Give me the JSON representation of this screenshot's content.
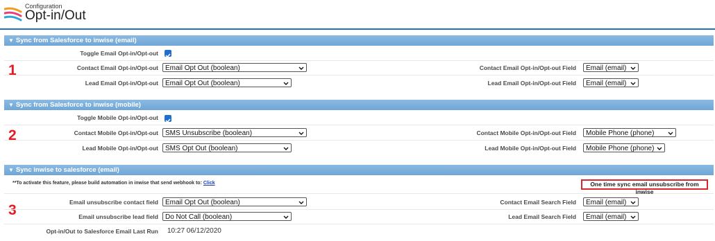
{
  "header": {
    "subtitle": "Configuration",
    "title": "Opt-in/Out"
  },
  "sections": [
    {
      "title": "Sync from Salesforce to inwise (email)",
      "number": "1",
      "toggle_label": "Toggle Email Opt-in/Opt-out",
      "toggle_checked": true,
      "contact_label": "Contact Email Opt-in/Opt-out",
      "contact_value": "Email Opt Out (boolean)",
      "contact_field_label": "Contact Email Opt-in/Opt-out Field",
      "contact_field_value": "Email (email)",
      "lead_label": "Lead Email Opt-in/Opt-out",
      "lead_value": "Email Opt Out (boolean)",
      "lead_field_label": "Lead Email Opt-in/Opt-out Field",
      "lead_field_value": "Email (email)"
    },
    {
      "title": "Sync from Salesforce to inwise (mobile)",
      "number": "2",
      "toggle_label": "Toggle Mobile Opt-in/Opt-out",
      "toggle_checked": true,
      "contact_label": "Contact Mobile Opt-in/Opt-out",
      "contact_value": "SMS Unsubscribe (boolean)",
      "contact_field_label": "Contact Mobile Opt-in/Opt-out Field",
      "contact_field_value": "Mobile Phone (phone)",
      "lead_label": "Lead Mobile Opt-in/Opt-out",
      "lead_value": "SMS Opt Out (boolean)",
      "lead_field_label": "Lead Mobile Opt-in/Opt-out Field",
      "lead_field_value": "Mobile Phone (phone)"
    },
    {
      "title": "Sync inwise to salesforce (email)",
      "number": "3",
      "note_text": "**To activate this feature, please build automation in inwise that send webhook to:",
      "note_link": "Click",
      "action_button": "One time sync email unsubscribe from inwise",
      "contact_label": "Email unsubscribe contact field",
      "contact_value": "Email Opt Out (boolean)",
      "contact_field_label": "Contact Email Search Field",
      "contact_field_value": "Email (email)",
      "lead_label": "Email unsubscribe lead field",
      "lead_value": "Do Not Call (boolean)",
      "lead_field_label": "Lead Email Search Field",
      "lead_field_value": "Email (email)",
      "last_run_label": "Opt-in/Out to Salesforce Email Last Run",
      "last_run_value": "10:27 06/12/2020"
    }
  ],
  "icons": {
    "section_toggle": "triangle-down-icon",
    "select_arrow": "chevron-down-icon",
    "logo": "inwise-logo-icon"
  },
  "colors": {
    "section_bar": "#7fb1dd",
    "accent_rule": "#1f74b9",
    "number_red": "#e51c23",
    "checkbox_blue": "#1f6fd0",
    "highlight_border": "#d8262c"
  }
}
